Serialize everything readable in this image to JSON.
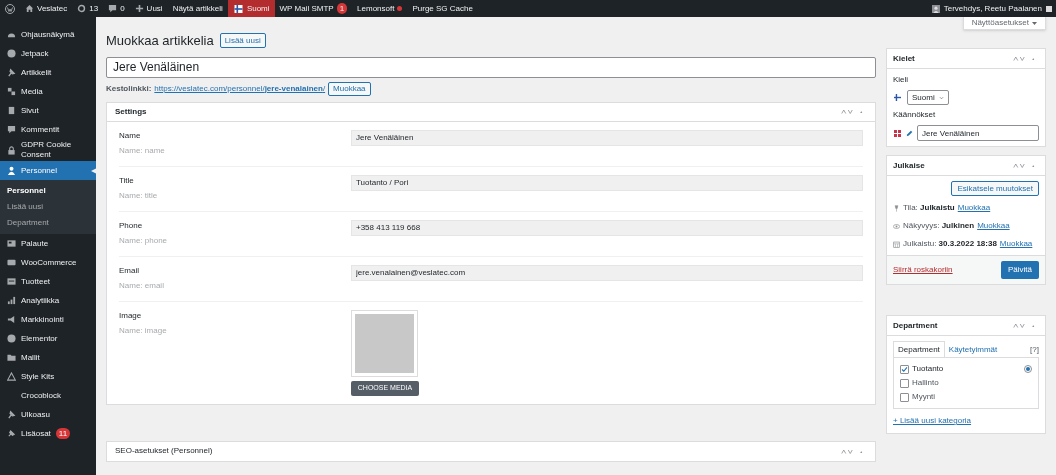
{
  "admin_bar": {
    "items": [
      {
        "kind": "logo"
      },
      {
        "kind": "home",
        "label": "Veslatec"
      },
      {
        "kind": "updates",
        "label": "13"
      },
      {
        "kind": "comments",
        "label": "0"
      },
      {
        "kind": "new",
        "label": "Uusi"
      },
      {
        "kind": "link",
        "label": "Näytä artikkeli"
      },
      {
        "kind": "language",
        "label": "Suomi"
      },
      {
        "kind": "badge",
        "label": "WP Mail SMTP",
        "badge": "1"
      },
      {
        "kind": "dot",
        "label": "Lemonsoft"
      },
      {
        "kind": "link",
        "label": "Purge SG Cache"
      }
    ],
    "greeting": "Tervehdys, Reetu Paalanen"
  },
  "sidebar": {
    "items": [
      {
        "label": "Ohjausnäkymä",
        "selected": false
      },
      {
        "label": "Jetpack",
        "selected": false
      },
      {
        "label": "Artikkelit",
        "selected": false
      },
      {
        "label": "Media",
        "selected": false
      },
      {
        "label": "Sivut",
        "selected": false
      },
      {
        "label": "Kommentit",
        "selected": false
      },
      {
        "label": "GDPR Cookie Consent",
        "selected": false
      },
      {
        "label": "Personnel",
        "selected": true,
        "children": [
          {
            "label": "Personnel",
            "selected": true
          },
          {
            "label": "Lisää uusi",
            "selected": false
          },
          {
            "label": "Department",
            "selected": false
          }
        ]
      },
      {
        "label": "Palaute",
        "selected": false
      },
      {
        "label": "WooCommerce",
        "selected": false
      },
      {
        "label": "Tuotteet",
        "selected": false
      },
      {
        "label": "Analytiikka",
        "selected": false
      },
      {
        "label": "Markkinointi",
        "selected": false
      },
      {
        "label": "Elementor",
        "selected": false
      },
      {
        "label": "Mallit",
        "selected": false
      },
      {
        "label": "Style Kits",
        "selected": false
      },
      {
        "label": "Crocoblock",
        "selected": false
      },
      {
        "label": "Ulkoasu",
        "selected": false
      },
      {
        "label": "Lisäosat",
        "selected": false,
        "badge": "11"
      }
    ]
  },
  "screen_options": "Näyttöasetukset",
  "page_title": "Muokkaa artikkelia",
  "add_new": "Lisää uusi",
  "post_title": "Jere Venäläinen",
  "permalink": {
    "label": "Kestolinkki:",
    "url": "https://veslatec.com/personnel/**jere-venalainen**/",
    "edit": "Muokkaa"
  },
  "settings": {
    "title": "Settings",
    "fields": [
      {
        "kind": "text",
        "label": "Name",
        "hint": "Name: name",
        "value": "Jere Venäläinen"
      },
      {
        "kind": "text",
        "label": "Title",
        "hint": "Name: title",
        "value": "Tuotanto / Pori"
      },
      {
        "kind": "text",
        "label": "Phone",
        "hint": "Name: phone",
        "value": "+358 413 119 668"
      },
      {
        "kind": "text",
        "label": "Email",
        "hint": "Name: email",
        "value": "jere.venalainen@veslatec.com"
      },
      {
        "kind": "image",
        "label": "Image",
        "hint": "Name: image",
        "button": "CHOOSE MEDIA"
      }
    ]
  },
  "seo_box": {
    "title": "SEO-asetukset (Personnel)"
  },
  "languages": {
    "title": "Kielet",
    "language_label": "Kieli",
    "language": "Suomi",
    "translations_label": "Käännökset",
    "translation": "Jere Venäläinen"
  },
  "publish": {
    "title": "Julkaise",
    "preview": "Esikatsele muutokset",
    "rows": [
      {
        "kind": "status",
        "label": "Tila:",
        "value": "Julkaistu",
        "link": "Muokkaa"
      },
      {
        "kind": "visibility",
        "label": "Näkyvyys:",
        "value": "Julkinen",
        "link": "Muokkaa"
      },
      {
        "kind": "date",
        "label": "Julkaistu:",
        "value": "30.3.2022 18:38",
        "link": "Muokkaa"
      }
    ],
    "trash": "Siirrä roskakoriin",
    "update": "Päivitä"
  },
  "department": {
    "title": "Department",
    "tabs": [
      {
        "label": "Department",
        "selected": true
      },
      {
        "label": "Käytetyimmät",
        "selected": false
      }
    ],
    "help": "[?]",
    "categories": [
      {
        "label": "Tuotanto",
        "checked": true,
        "primary": true
      },
      {
        "label": "Hallinto",
        "checked": false,
        "primary": false
      },
      {
        "label": "Myynti",
        "checked": false,
        "primary": false
      }
    ],
    "add": "+ Lisää uusi kategoria"
  }
}
